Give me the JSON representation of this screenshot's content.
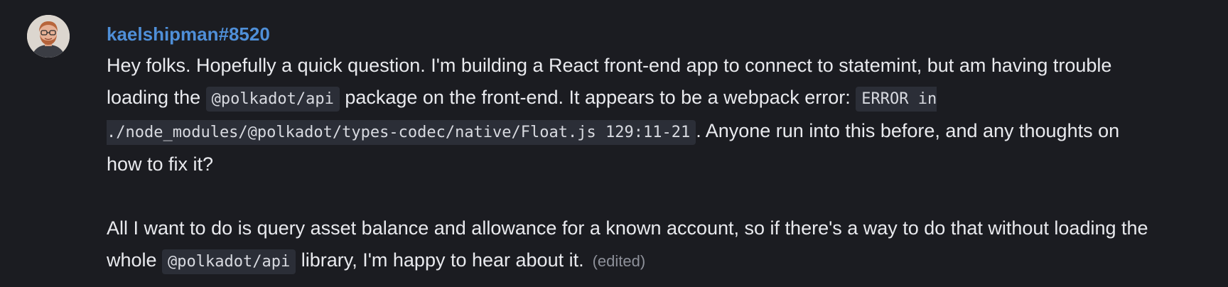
{
  "message": {
    "username": "kaelshipman#8520",
    "avatar_icon": "user-avatar-photo",
    "paragraph1": {
      "t1": "Hey folks. Hopefully a quick question. I'm building a React front-end app to connect to statemint, but am having trouble loading the ",
      "code1": "@polkadot/api",
      "t2": " package on the front-end. It appears to be a webpack error: ",
      "code2": "ERROR in ./node_modules/@polkadot/types-codec/native/Float.js 129:11-21",
      "t3": ". Anyone run into this before, and any thoughts on how to fix it?"
    },
    "paragraph2": {
      "t1": "All I want to do is query asset balance and allowance for a known account, so if there's a way to do that without loading the whole ",
      "code1": "@polkadot/api",
      "t2": " library, I'm happy to hear about it."
    },
    "edited_label": "(edited)"
  },
  "colors": {
    "background": "#1b1c21",
    "username": "#4f8fd8",
    "text": "#e9eaee",
    "code_background": "#2b2e37",
    "muted": "#8d9099"
  }
}
